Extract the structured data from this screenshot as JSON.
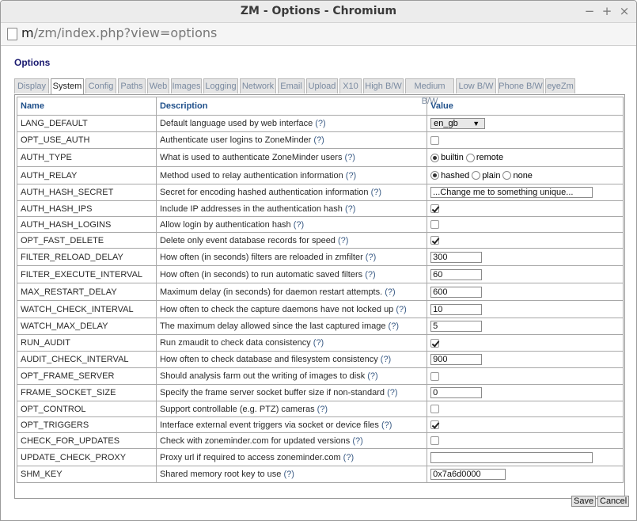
{
  "window": {
    "title": "ZM - Options - Chromium",
    "url_host": "m",
    "url_path": "/zm/index.php?view=options",
    "controls": [
      "✕",
      "−",
      "+",
      "×"
    ]
  },
  "page": {
    "heading": "Options"
  },
  "tabs": [
    "Display",
    "System",
    "Config",
    "Paths",
    "Web",
    "Images",
    "Logging",
    "Network",
    "Email",
    "Upload",
    "X10",
    "High B/W",
    "Medium B/W",
    "Low B/W",
    "Phone B/W",
    "eyeZm"
  ],
  "active_tab": "System",
  "columns": {
    "name": "Name",
    "description": "Description",
    "value": "Value"
  },
  "help_marker": "(?)",
  "rows": [
    {
      "name": "LANG_DEFAULT",
      "desc": "Default language used by web interface",
      "type": "select",
      "value": "en_gb"
    },
    {
      "name": "OPT_USE_AUTH",
      "desc": "Authenticate user logins to ZoneMinder",
      "type": "checkbox",
      "checked": false
    },
    {
      "name": "AUTH_TYPE",
      "desc": "What is used to authenticate ZoneMinder users",
      "type": "radio",
      "options": [
        "builtin",
        "remote"
      ],
      "selected": "builtin"
    },
    {
      "name": "AUTH_RELAY",
      "desc": "Method used to relay authentication information",
      "type": "radio",
      "options": [
        "hashed",
        "plain",
        "none"
      ],
      "selected": "hashed"
    },
    {
      "name": "AUTH_HASH_SECRET",
      "desc": "Secret for encoding hashed authentication information",
      "type": "text",
      "value": "...Change me to something unique...",
      "wide": true
    },
    {
      "name": "AUTH_HASH_IPS",
      "desc": "Include IP addresses in the authentication hash",
      "type": "checkbox",
      "checked": true
    },
    {
      "name": "AUTH_HASH_LOGINS",
      "desc": "Allow login by authentication hash",
      "type": "checkbox",
      "checked": false
    },
    {
      "name": "OPT_FAST_DELETE",
      "desc": "Delete only event database records for speed",
      "type": "checkbox",
      "checked": true
    },
    {
      "name": "FILTER_RELOAD_DELAY",
      "desc": "How often (in seconds) filters are reloaded in zmfilter",
      "type": "text",
      "value": "300"
    },
    {
      "name": "FILTER_EXECUTE_INTERVAL",
      "desc": "How often (in seconds) to run automatic saved filters",
      "type": "text",
      "value": "60"
    },
    {
      "name": "MAX_RESTART_DELAY",
      "desc": "Maximum delay (in seconds) for daemon restart attempts.",
      "type": "text",
      "value": "600"
    },
    {
      "name": "WATCH_CHECK_INTERVAL",
      "desc": "How often to check the capture daemons have not locked up",
      "type": "text",
      "value": "10"
    },
    {
      "name": "WATCH_MAX_DELAY",
      "desc": "The maximum delay allowed since the last captured image",
      "type": "text",
      "value": "5"
    },
    {
      "name": "RUN_AUDIT",
      "desc": "Run zmaudit to check data consistency",
      "type": "checkbox",
      "checked": true
    },
    {
      "name": "AUDIT_CHECK_INTERVAL",
      "desc": "How often to check database and filesystem consistency",
      "type": "text",
      "value": "900"
    },
    {
      "name": "OPT_FRAME_SERVER",
      "desc": "Should analysis farm out the writing of images to disk",
      "type": "checkbox",
      "checked": false
    },
    {
      "name": "FRAME_SOCKET_SIZE",
      "desc": "Specify the frame server socket buffer size if non-standard",
      "type": "text",
      "value": "0"
    },
    {
      "name": "OPT_CONTROL",
      "desc": "Support controllable (e.g. PTZ) cameras",
      "type": "checkbox",
      "checked": false
    },
    {
      "name": "OPT_TRIGGERS",
      "desc": "Interface external event triggers via socket or device files",
      "type": "checkbox",
      "checked": true
    },
    {
      "name": "CHECK_FOR_UPDATES",
      "desc": "Check with zoneminder.com for updated versions",
      "type": "checkbox",
      "checked": false
    },
    {
      "name": "UPDATE_CHECK_PROXY",
      "desc": "Proxy url if required to access zoneminder.com",
      "type": "text",
      "value": "",
      "wide": true
    },
    {
      "name": "SHM_KEY",
      "desc": "Shared memory root key to use",
      "type": "text",
      "value": "0x7a6d0000",
      "mid": true
    }
  ],
  "buttons": {
    "save": "Save",
    "cancel": "Cancel"
  }
}
